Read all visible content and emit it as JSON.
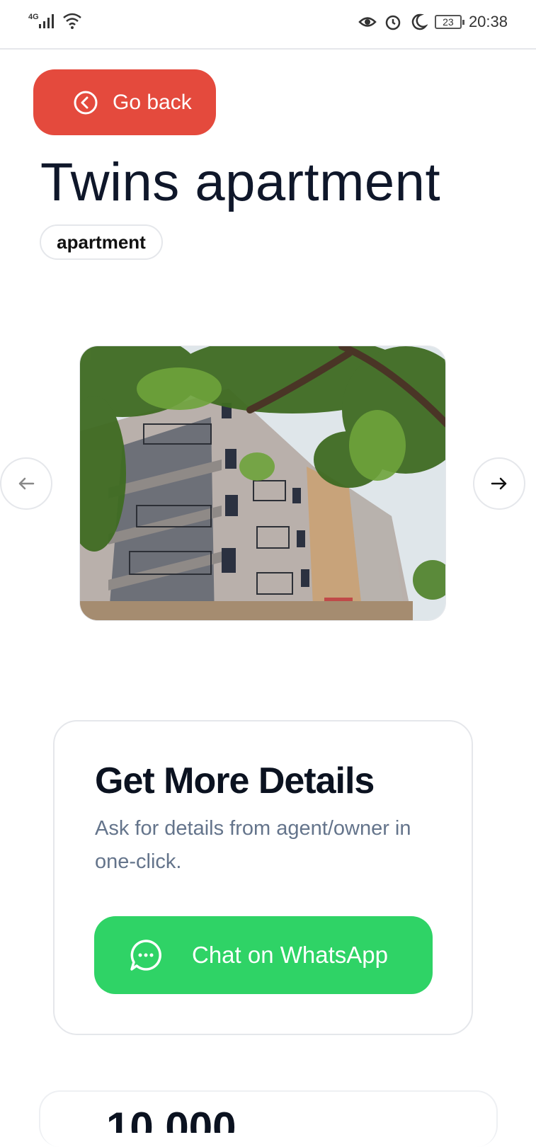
{
  "status_bar": {
    "network": "4G",
    "battery": "23",
    "time": "20:38"
  },
  "back_button": {
    "label": "Go back"
  },
  "listing": {
    "title": "Twins apartment",
    "type_tag": "apartment"
  },
  "details_card": {
    "title": "Get More Details",
    "description": "Ask for details from agent/owner in one-click.",
    "whatsapp_button": "Chat on WhatsApp"
  },
  "price_peek": "10,000",
  "colors": {
    "back_button": "#e44a3d",
    "whatsapp_button": "#2fd366",
    "title_text": "#0f172a",
    "muted_text": "#64748b"
  },
  "icons": [
    "signal-icon",
    "wifi-icon",
    "eye-icon",
    "alarm-icon",
    "moon-icon",
    "battery-icon",
    "chevron-left-circle-icon",
    "arrow-left-icon",
    "arrow-right-icon",
    "whatsapp-chat-icon"
  ]
}
